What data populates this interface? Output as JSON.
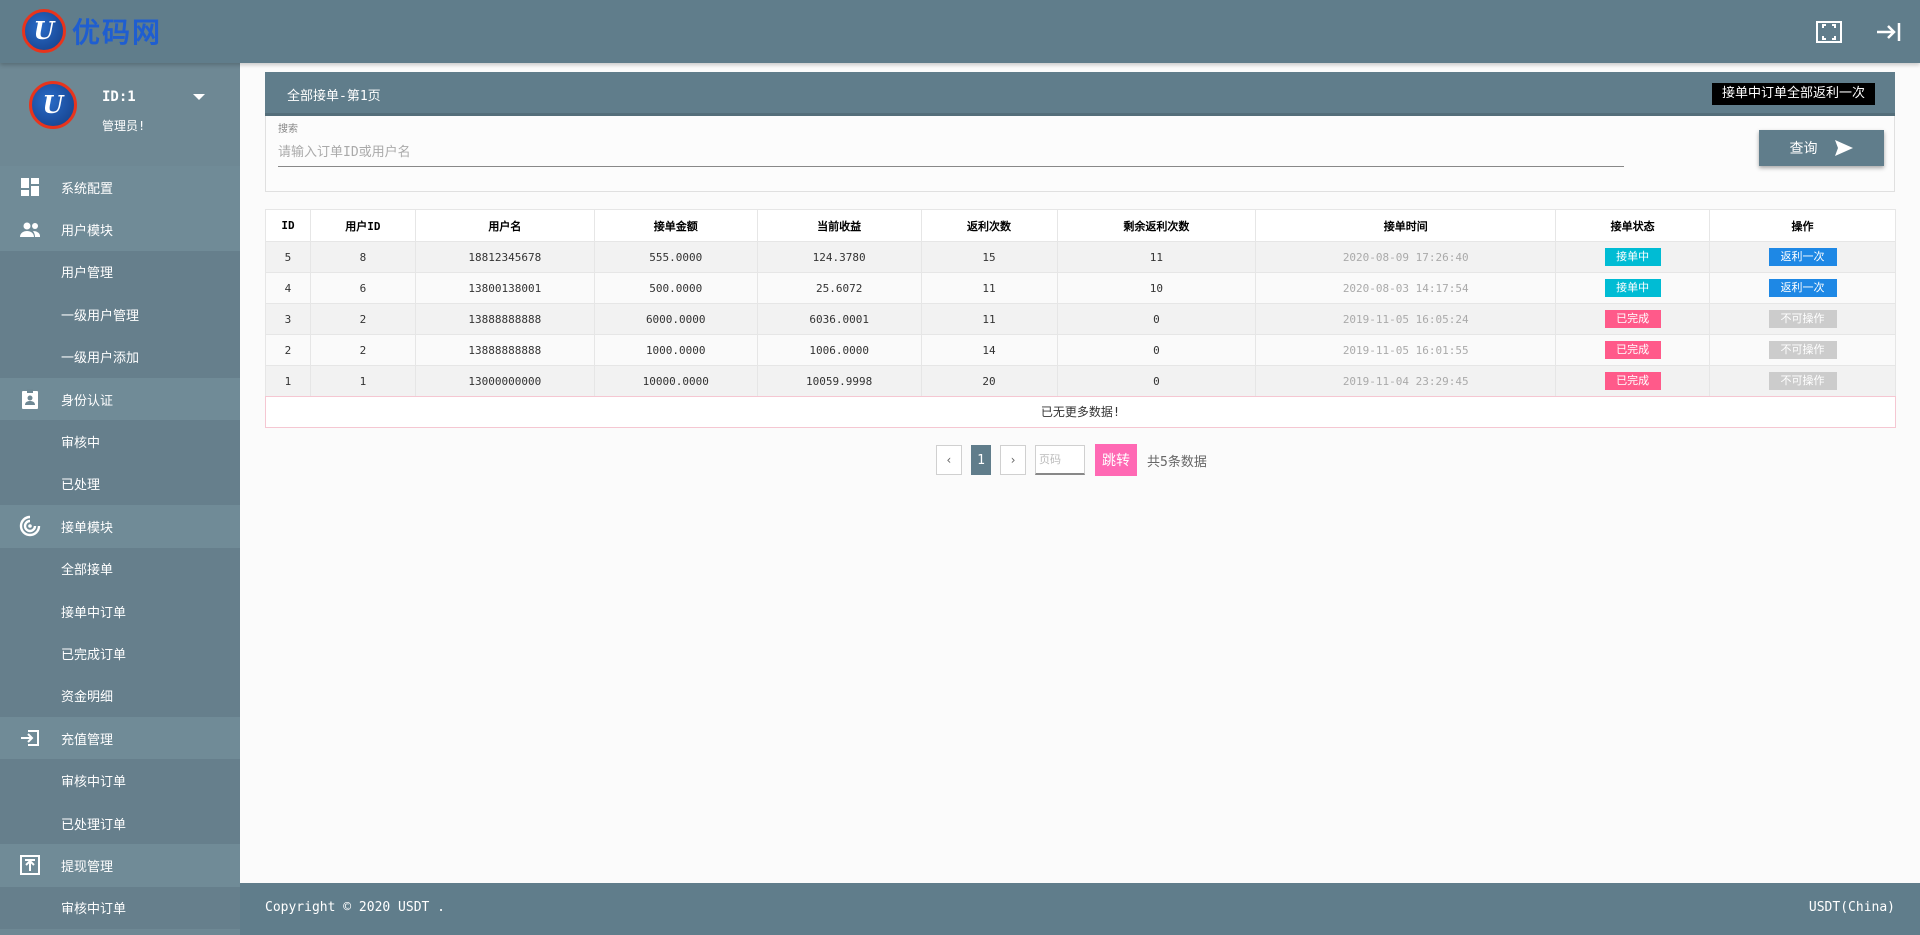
{
  "header": {
    "logo_letter": "U",
    "logo_text": "优码网",
    "fullscreen_icon": "fullscreen-icon",
    "logout_icon": "logout-icon"
  },
  "profile": {
    "id_label": "ID:1",
    "role": "管理员!"
  },
  "sidebar": {
    "items": [
      {
        "type": "group",
        "label": "系统配置",
        "icon": "dashboard-icon"
      },
      {
        "type": "group",
        "label": "用户模块",
        "icon": "users-icon"
      },
      {
        "type": "sub",
        "label": "用户管理"
      },
      {
        "type": "sub",
        "label": "一级用户管理"
      },
      {
        "type": "sub",
        "label": "一级用户添加"
      },
      {
        "type": "group",
        "label": "身份认证",
        "icon": "id-badge-icon"
      },
      {
        "type": "sub",
        "label": "审核中"
      },
      {
        "type": "sub",
        "label": "已处理"
      },
      {
        "type": "group",
        "label": "接单模块",
        "icon": "radar-icon"
      },
      {
        "type": "sub",
        "label": "全部接单"
      },
      {
        "type": "sub",
        "label": "接单中订单"
      },
      {
        "type": "sub",
        "label": "已完成订单"
      },
      {
        "type": "sub",
        "label": "资金明细"
      },
      {
        "type": "group",
        "label": "充值管理",
        "icon": "login-box-icon"
      },
      {
        "type": "sub",
        "label": "审核中订单"
      },
      {
        "type": "sub",
        "label": "已处理订单"
      },
      {
        "type": "group",
        "label": "提现管理",
        "icon": "upload-box-icon"
      },
      {
        "type": "sub",
        "label": "审核中订单"
      }
    ]
  },
  "panel": {
    "title": "全部接单-第1页",
    "rebate_all_button": "接单中订单全部返利一次"
  },
  "search": {
    "label": "搜索",
    "placeholder": "请输入订单ID或用户名",
    "value": "",
    "query_button": "查询"
  },
  "table": {
    "headers": [
      "ID",
      "用户ID",
      "用户名",
      "接单金额",
      "当前收益",
      "返利次数",
      "剩余返利次数",
      "接单时间",
      "接单状态",
      "操作"
    ],
    "rows": [
      {
        "id": "5",
        "user_id": "8",
        "username": "18812345678",
        "amount": "555.0000",
        "income": "124.3780",
        "rebates": "15",
        "remaining": "11",
        "time": "2020-08-09 17:26:40",
        "status": "接单中",
        "status_color": "#00bcd4",
        "action": "返利一次",
        "action_enabled": true
      },
      {
        "id": "4",
        "user_id": "6",
        "username": "13800138001",
        "amount": "500.0000",
        "income": "25.6072",
        "rebates": "11",
        "remaining": "10",
        "time": "2020-08-03 14:17:54",
        "status": "接单中",
        "status_color": "#00bcd4",
        "action": "返利一次",
        "action_enabled": true
      },
      {
        "id": "3",
        "user_id": "2",
        "username": "13888888888",
        "amount": "6000.0000",
        "income": "6036.0001",
        "rebates": "11",
        "remaining": "0",
        "time": "2019-11-05 16:05:24",
        "status": "已完成",
        "status_color": "#ff5a8a",
        "action": "不可操作",
        "action_enabled": false
      },
      {
        "id": "2",
        "user_id": "2",
        "username": "13888888888",
        "amount": "1000.0000",
        "income": "1006.0000",
        "rebates": "14",
        "remaining": "0",
        "time": "2019-11-05 16:01:55",
        "status": "已完成",
        "status_color": "#ff5a8a",
        "action": "不可操作",
        "action_enabled": false
      },
      {
        "id": "1",
        "user_id": "1",
        "username": "13000000000",
        "amount": "10000.0000",
        "income": "10059.9998",
        "rebates": "20",
        "remaining": "0",
        "time": "2019-11-04 23:29:45",
        "status": "已完成",
        "status_color": "#ff5a8a",
        "action": "不可操作",
        "action_enabled": false
      }
    ],
    "no_more": "已无更多数据!"
  },
  "pagination": {
    "prev": "‹",
    "current": "1",
    "next": "›",
    "page_placeholder": "页码",
    "go_button": "跳转",
    "total": "共5条数据"
  },
  "footer": {
    "copyright": "Copyright © 2020 USDT .",
    "brand": "USDT(China)"
  },
  "colors": {
    "primary": "#607d8b",
    "sidebar": "#6e8894",
    "status_active": "#00bcd4",
    "status_done": "#ff5a8a",
    "action_button": "#1e88e5",
    "go_button": "#ff69b4"
  }
}
